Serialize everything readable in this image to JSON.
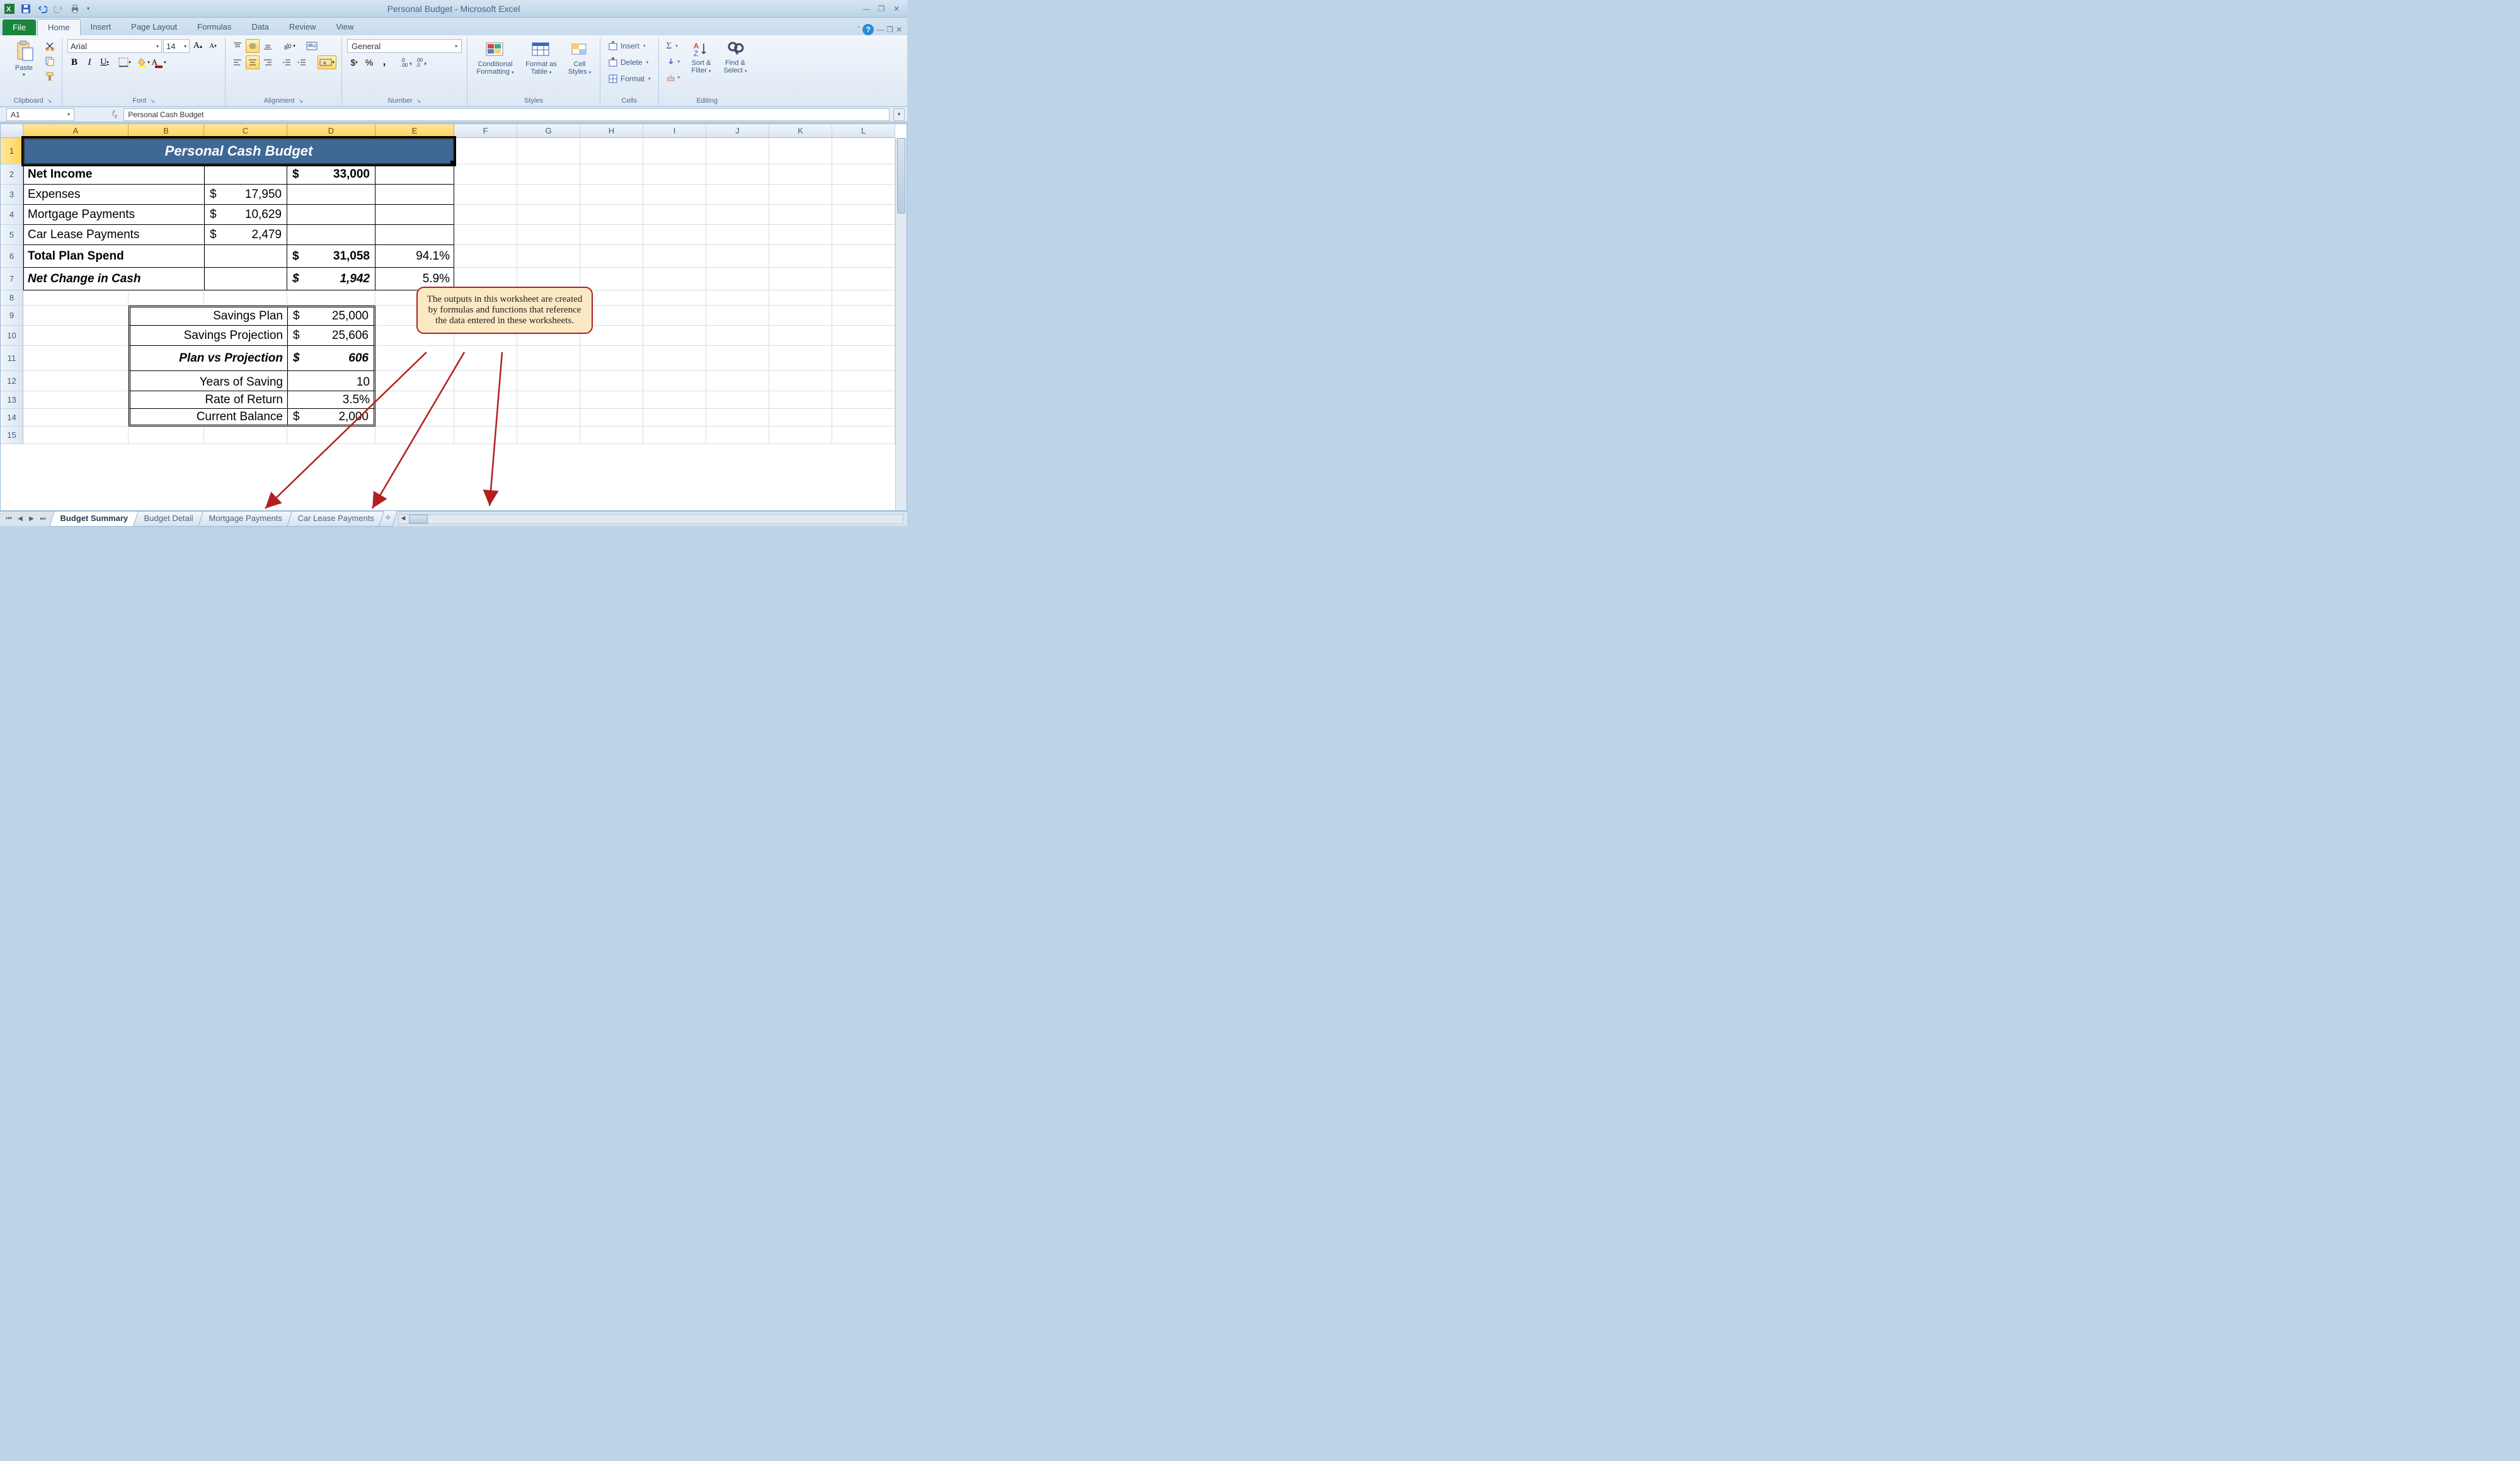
{
  "title": "Personal Budget - Microsoft Excel",
  "tabs": {
    "file": "File",
    "home": "Home",
    "insert": "Insert",
    "pagelayout": "Page Layout",
    "formulas": "Formulas",
    "data": "Data",
    "review": "Review",
    "view": "View"
  },
  "ribbon": {
    "clipboard": {
      "label": "Clipboard",
      "paste": "Paste"
    },
    "font": {
      "label": "Font",
      "name": "Arial",
      "size": "14"
    },
    "alignment": {
      "label": "Alignment"
    },
    "number": {
      "label": "Number",
      "format": "General"
    },
    "styles": {
      "label": "Styles",
      "cond": "Conditional",
      "cond2": "Formatting",
      "fat": "Format as",
      "fat2": "Table",
      "cs": "Cell",
      "cs2": "Styles"
    },
    "cells": {
      "label": "Cells",
      "insert": "Insert",
      "delete": "Delete",
      "format": "Format"
    },
    "editing": {
      "label": "Editing",
      "sort": "Sort &",
      "sort2": "Filter",
      "find": "Find &",
      "find2": "Select"
    }
  },
  "namebox": "A1",
  "formula": "Personal Cash Budget",
  "cols": [
    "A",
    "B",
    "C",
    "D",
    "E",
    "F",
    "G",
    "H",
    "I",
    "J",
    "K",
    "L"
  ],
  "rows": [
    "1",
    "2",
    "3",
    "4",
    "5",
    "6",
    "7",
    "8",
    "9",
    "10",
    "11",
    "12",
    "13",
    "14",
    "15"
  ],
  "sheet": {
    "title": "Personal Cash Budget",
    "r2a": "Net Income",
    "r2d": "33,000",
    "r3a": "Expenses",
    "r3c": "17,950",
    "r4a": "Mortgage Payments",
    "r4c": "10,629",
    "r5a": "Car Lease Payments",
    "r5c": "2,479",
    "r6a": "Total Plan Spend",
    "r6d": "31,058",
    "r6e": "94.1%",
    "r7a": "Net Change in Cash",
    "r7d": "1,942",
    "r7e": "5.9%",
    "r9bc": "Savings Plan",
    "r9d": "25,000",
    "r10bc": "Savings Projection",
    "r10d": "25,606",
    "r11bc": "Plan vs Projection",
    "r11d": "606",
    "r12bc": "Years of Saving",
    "r12d": "10",
    "r13bc": "Rate of Return",
    "r13d": "3.5%",
    "r14bc": "Current Balance",
    "r14d": "2,000",
    "dollar": "$"
  },
  "callout": "The outputs in this worksheet are created by formulas and functions that reference the data entered in these worksheets.",
  "sheets": {
    "s1": "Budget Summary",
    "s2": "Budget Detail",
    "s3": "Mortgage Payments",
    "s4": "Car Lease Payments"
  },
  "chart_data": {
    "type": "table",
    "title": "Personal Cash Budget",
    "rows": [
      {
        "label": "Net Income",
        "detail": null,
        "amount": 33000,
        "pct": null
      },
      {
        "label": "Expenses",
        "detail": 17950,
        "amount": null,
        "pct": null
      },
      {
        "label": "Mortgage Payments",
        "detail": 10629,
        "amount": null,
        "pct": null
      },
      {
        "label": "Car Lease Payments",
        "detail": 2479,
        "amount": null,
        "pct": null
      },
      {
        "label": "Total Plan Spend",
        "detail": null,
        "amount": 31058,
        "pct": 94.1
      },
      {
        "label": "Net Change in Cash",
        "detail": null,
        "amount": 1942,
        "pct": 5.9
      }
    ],
    "savings_box": [
      {
        "label": "Savings Plan",
        "value": 25000,
        "unit": "$"
      },
      {
        "label": "Savings Projection",
        "value": 25606,
        "unit": "$"
      },
      {
        "label": "Plan vs Projection",
        "value": 606,
        "unit": "$"
      },
      {
        "label": "Years of Saving",
        "value": 10,
        "unit": ""
      },
      {
        "label": "Rate of Return",
        "value": 3.5,
        "unit": "%"
      },
      {
        "label": "Current Balance",
        "value": 2000,
        "unit": "$"
      }
    ]
  }
}
